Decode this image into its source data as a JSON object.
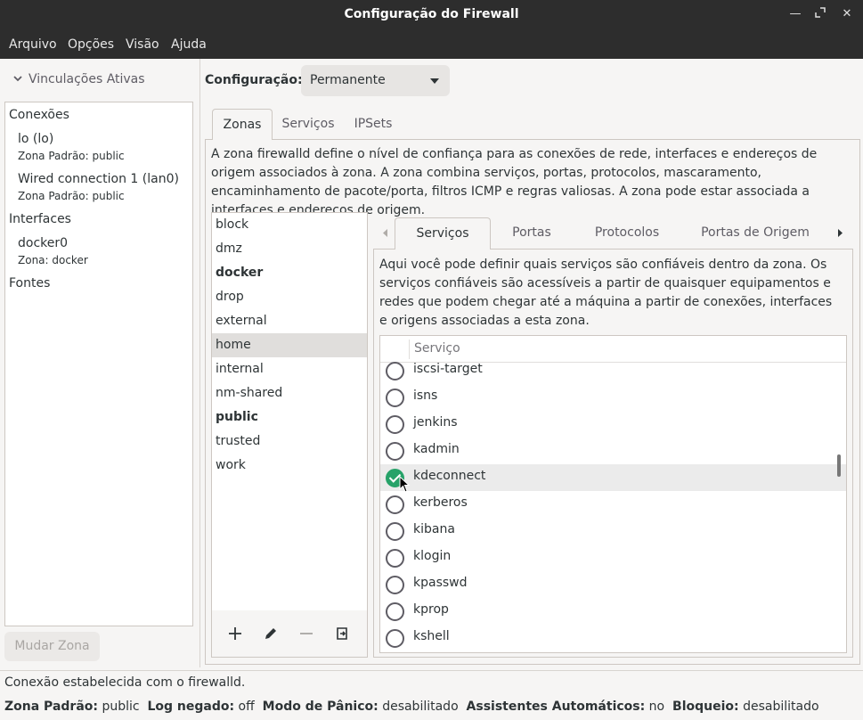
{
  "window": {
    "title": "Configuração do Firewall"
  },
  "menu": [
    "Arquivo",
    "Opções",
    "Visão",
    "Ajuda"
  ],
  "left": {
    "header": "Vinculações Ativas",
    "sections": {
      "connections": "Conexões",
      "conn1_name": "lo (lo)",
      "conn1_zone": "Zona Padrão: public",
      "conn2_name": "Wired connection 1 (lan0)",
      "conn2_zone": "Zona Padrão: public",
      "interfaces": "Interfaces",
      "iface1_name": "docker0",
      "iface1_zone": "Zona: docker",
      "sources": "Fontes"
    },
    "change_zone_button": "Mudar Zona"
  },
  "config": {
    "label": "Configuração:",
    "value": "Permanente"
  },
  "tabs": [
    "Zonas",
    "Serviços",
    "IPSets"
  ],
  "zones_description": "A zona firewalld define o nível de confiança para as conexões de rede, interfaces e endereços de origem associados à zona. A zona combina serviços, portas, protocolos, mascaramento, encaminhamento de pacote/porta, filtros ICMP e regras valiosas. A zona pode estar associada a interfaces e endereços de origem.",
  "zones": [
    {
      "name": "block",
      "bold": false,
      "selected": false
    },
    {
      "name": "dmz",
      "bold": false,
      "selected": false
    },
    {
      "name": "docker",
      "bold": true,
      "selected": false
    },
    {
      "name": "drop",
      "bold": false,
      "selected": false
    },
    {
      "name": "external",
      "bold": false,
      "selected": false
    },
    {
      "name": "home",
      "bold": false,
      "selected": true
    },
    {
      "name": "internal",
      "bold": false,
      "selected": false
    },
    {
      "name": "nm-shared",
      "bold": false,
      "selected": false
    },
    {
      "name": "public",
      "bold": true,
      "selected": false
    },
    {
      "name": "trusted",
      "bold": false,
      "selected": false
    },
    {
      "name": "work",
      "bold": false,
      "selected": false
    }
  ],
  "inner_tabs": [
    "Serviços",
    "Portas",
    "Protocolos",
    "Portas de Origem"
  ],
  "services_description": "Aqui você pode definir quais serviços são confiáveis dentro da zona. Os serviços confiáveis são acessíveis a partir de quaisquer equipamentos e redes que podem chegar até a máquina a partir de conexões, interfaces e origens associadas a esta zona.",
  "services_table": {
    "column_header": "Serviço",
    "rows": [
      {
        "name": "iscsi-target",
        "checked": false
      },
      {
        "name": "isns",
        "checked": false
      },
      {
        "name": "jenkins",
        "checked": false
      },
      {
        "name": "kadmin",
        "checked": false
      },
      {
        "name": "kdeconnect",
        "checked": true
      },
      {
        "name": "kerberos",
        "checked": false
      },
      {
        "name": "kibana",
        "checked": false
      },
      {
        "name": "klogin",
        "checked": false
      },
      {
        "name": "kpasswd",
        "checked": false
      },
      {
        "name": "kprop",
        "checked": false
      },
      {
        "name": "kshell",
        "checked": false
      }
    ]
  },
  "status": {
    "message": "Conexão estabelecida com o firewalld.",
    "default_zone_label": "Zona Padrão:",
    "default_zone_value": "public",
    "log_denied_label": "Log negado:",
    "log_denied_value": "off",
    "panic_label": "Modo de Pânico:",
    "panic_value": "desabilitado",
    "helpers_label": "Assistentes Automáticos:",
    "helpers_value": "no",
    "lockdown_label": "Bloqueio:",
    "lockdown_value": "desabilitado"
  },
  "colors": {
    "check": "#26a269",
    "titlebar": "#2d2d2d",
    "selected_row": "#e0dedc"
  }
}
